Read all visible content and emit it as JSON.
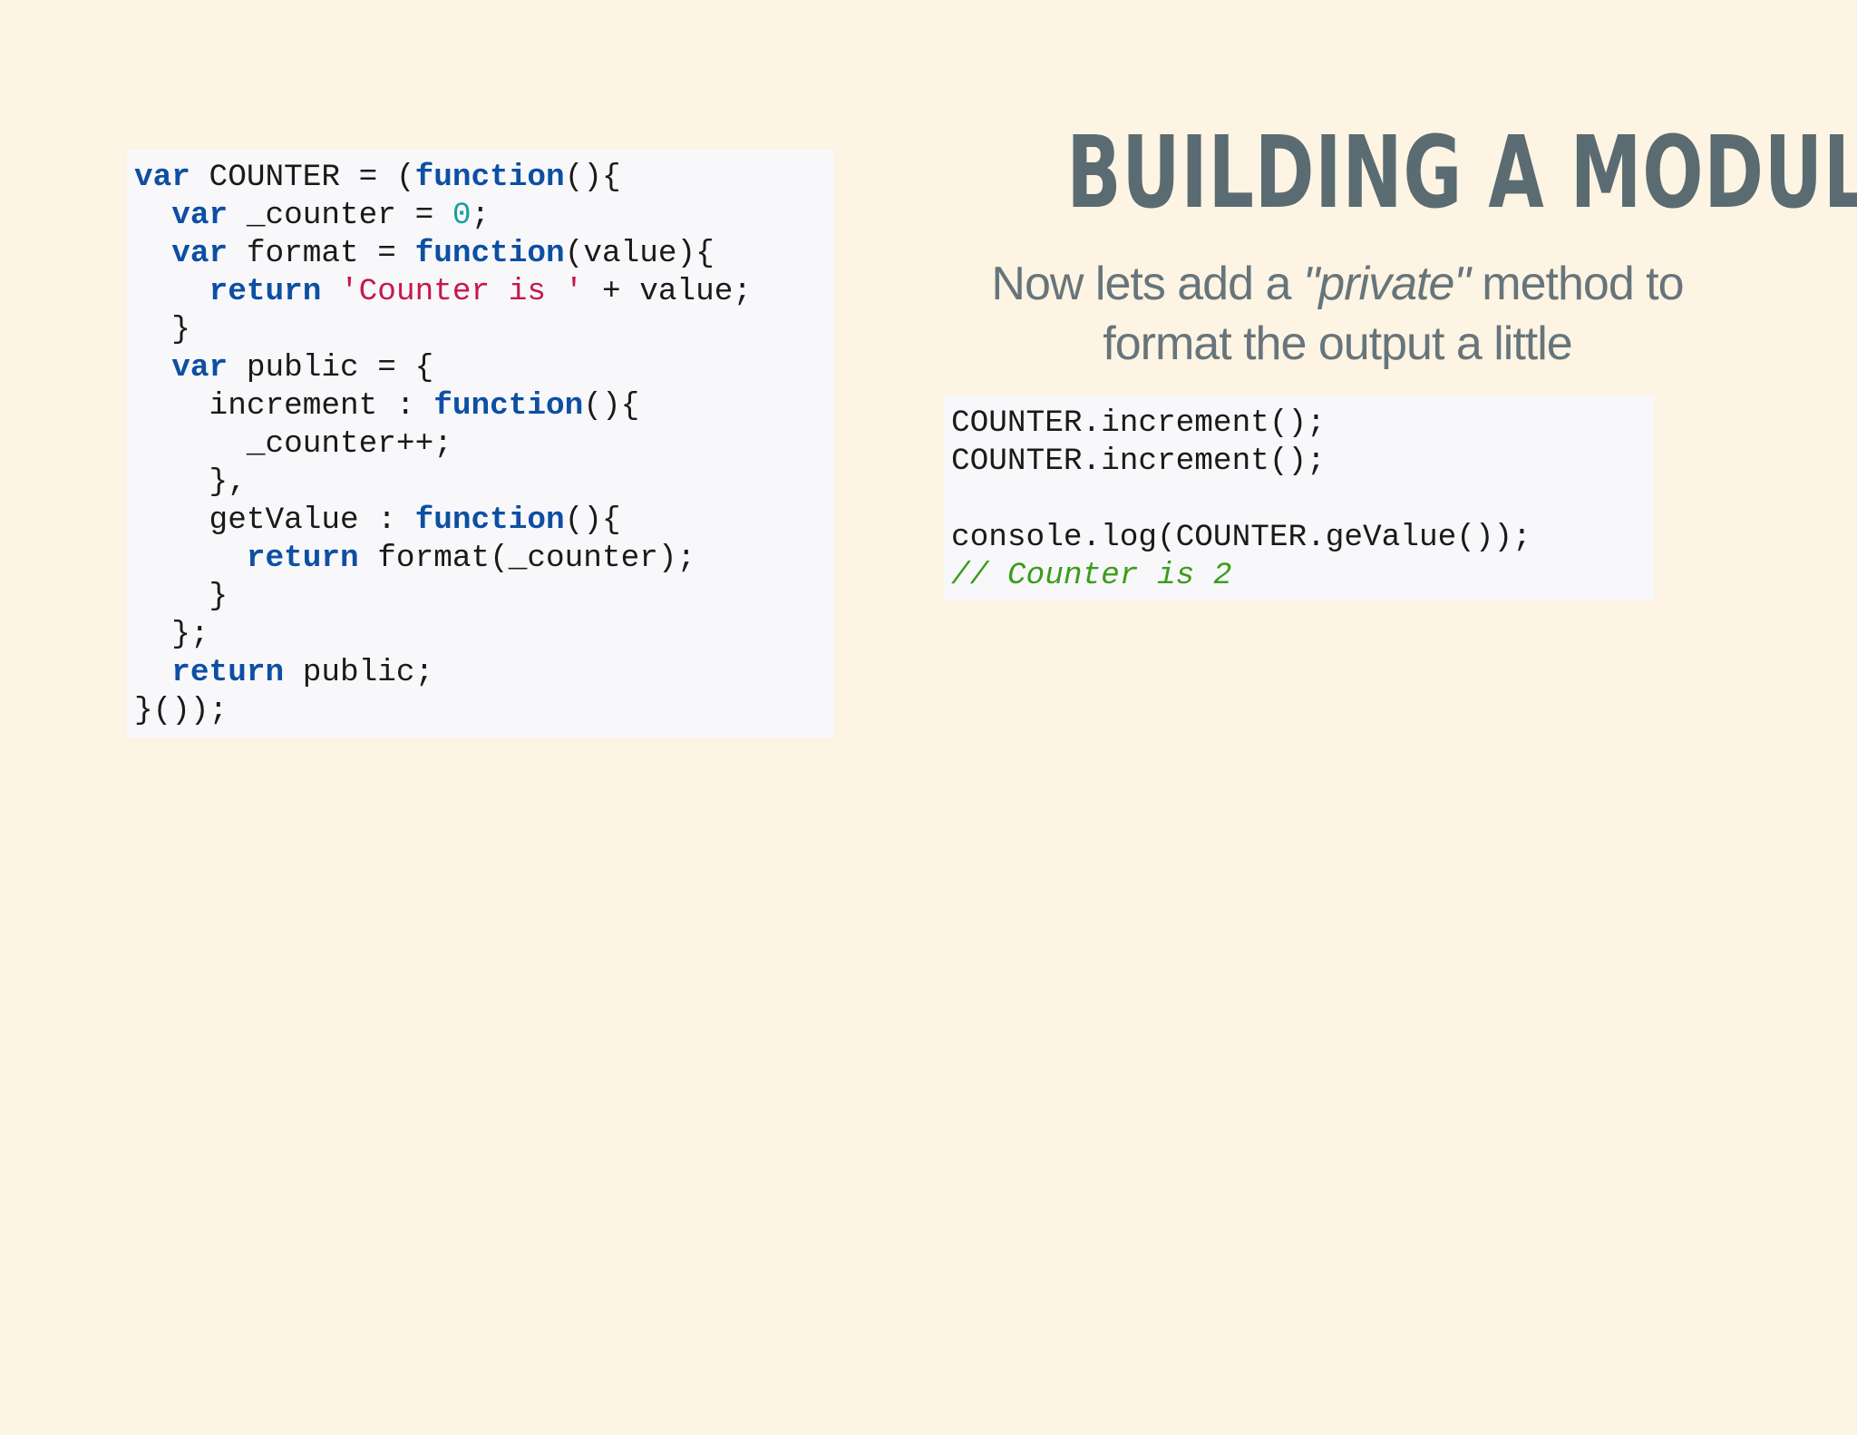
{
  "slide": {
    "title": "BUILDING A MODULE",
    "subtitle": {
      "before": "Now lets add a ",
      "emphasis": "\"private\"",
      "after": " method to format the output a little"
    }
  },
  "code_left": {
    "lines": [
      [
        {
          "t": "kw",
          "v": "var"
        },
        {
          "t": "pl",
          "v": " COUNTER = ("
        },
        {
          "t": "kw",
          "v": "function"
        },
        {
          "t": "pl",
          "v": "(){"
        }
      ],
      [
        {
          "t": "pl",
          "v": "  "
        },
        {
          "t": "kw",
          "v": "var"
        },
        {
          "t": "pl",
          "v": " _counter = "
        },
        {
          "t": "num",
          "v": "0"
        },
        {
          "t": "pl",
          "v": ";"
        }
      ],
      [
        {
          "t": "pl",
          "v": "  "
        },
        {
          "t": "kw",
          "v": "var"
        },
        {
          "t": "pl",
          "v": " format = "
        },
        {
          "t": "kw",
          "v": "function"
        },
        {
          "t": "pl",
          "v": "(value){"
        }
      ],
      [
        {
          "t": "pl",
          "v": "    "
        },
        {
          "t": "kw",
          "v": "return"
        },
        {
          "t": "pl",
          "v": " "
        },
        {
          "t": "str",
          "v": "'Counter is '"
        },
        {
          "t": "pl",
          "v": " + value;"
        }
      ],
      [
        {
          "t": "pl",
          "v": "  }"
        }
      ],
      [
        {
          "t": "pl",
          "v": "  "
        },
        {
          "t": "kw",
          "v": "var"
        },
        {
          "t": "pl",
          "v": " public = {"
        }
      ],
      [
        {
          "t": "pl",
          "v": "    increment : "
        },
        {
          "t": "kw",
          "v": "function"
        },
        {
          "t": "pl",
          "v": "(){"
        }
      ],
      [
        {
          "t": "pl",
          "v": "      _counter++;"
        }
      ],
      [
        {
          "t": "pl",
          "v": "    },"
        }
      ],
      [
        {
          "t": "pl",
          "v": "    getValue : "
        },
        {
          "t": "kw",
          "v": "function"
        },
        {
          "t": "pl",
          "v": "(){"
        }
      ],
      [
        {
          "t": "pl",
          "v": "      "
        },
        {
          "t": "kw",
          "v": "return"
        },
        {
          "t": "pl",
          "v": " format(_counter);"
        }
      ],
      [
        {
          "t": "pl",
          "v": "    }"
        }
      ],
      [
        {
          "t": "pl",
          "v": "  };"
        }
      ],
      [
        {
          "t": "pl",
          "v": "  "
        },
        {
          "t": "kw",
          "v": "return"
        },
        {
          "t": "pl",
          "v": " public;"
        }
      ],
      [
        {
          "t": "pl",
          "v": "}());"
        }
      ]
    ]
  },
  "code_right": {
    "lines": [
      [
        {
          "t": "pl",
          "v": "COUNTER.increment();"
        }
      ],
      [
        {
          "t": "pl",
          "v": "COUNTER.increment();"
        }
      ],
      [
        {
          "t": "pl",
          "v": ""
        }
      ],
      [
        {
          "t": "pl",
          "v": "console.log(COUNTER.geValue());"
        }
      ],
      [
        {
          "t": "cmt",
          "v": "// Counter is 2"
        }
      ]
    ]
  },
  "colors": {
    "background": "#fdf4e3",
    "code_background": "#f8f8fb",
    "keyword": "#0d4fa3",
    "string": "#c8174a",
    "number": "#1a9da0",
    "comment": "#3a9d1a",
    "title": "#5a6b72",
    "subtitle": "#67757b"
  }
}
